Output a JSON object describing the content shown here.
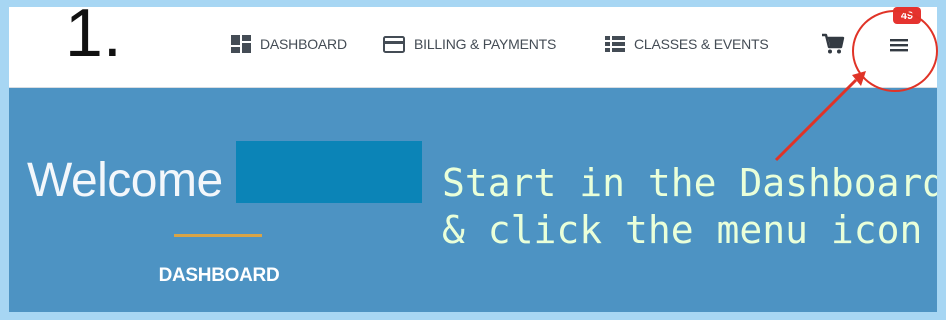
{
  "step_number": "1.",
  "nav": {
    "items": [
      {
        "label": "DASHBOARD",
        "icon": "dashboard-icon"
      },
      {
        "label": "BILLING & PAYMENTS",
        "icon": "credit-card-icon"
      },
      {
        "label": "CLASSES & EVENTS",
        "icon": "list-icon"
      }
    ],
    "cart_icon": "cart-icon",
    "menu_icon": "hamburger-menu-icon",
    "notification_count": "49"
  },
  "hero": {
    "welcome": "Welcome",
    "subtitle": "DASHBOARD"
  },
  "annotation": {
    "line1": "Start in the Dashboard",
    "line2": "& click the menu icon"
  },
  "colors": {
    "hero_bg": "#4d93c3",
    "outer_bg": "#a7d6f3",
    "accent_rule": "#d8a447",
    "badge": "#e5332f",
    "annotation_text": "#e9ffd9",
    "callout": "#e03327",
    "redaction": "#0b84b7"
  }
}
